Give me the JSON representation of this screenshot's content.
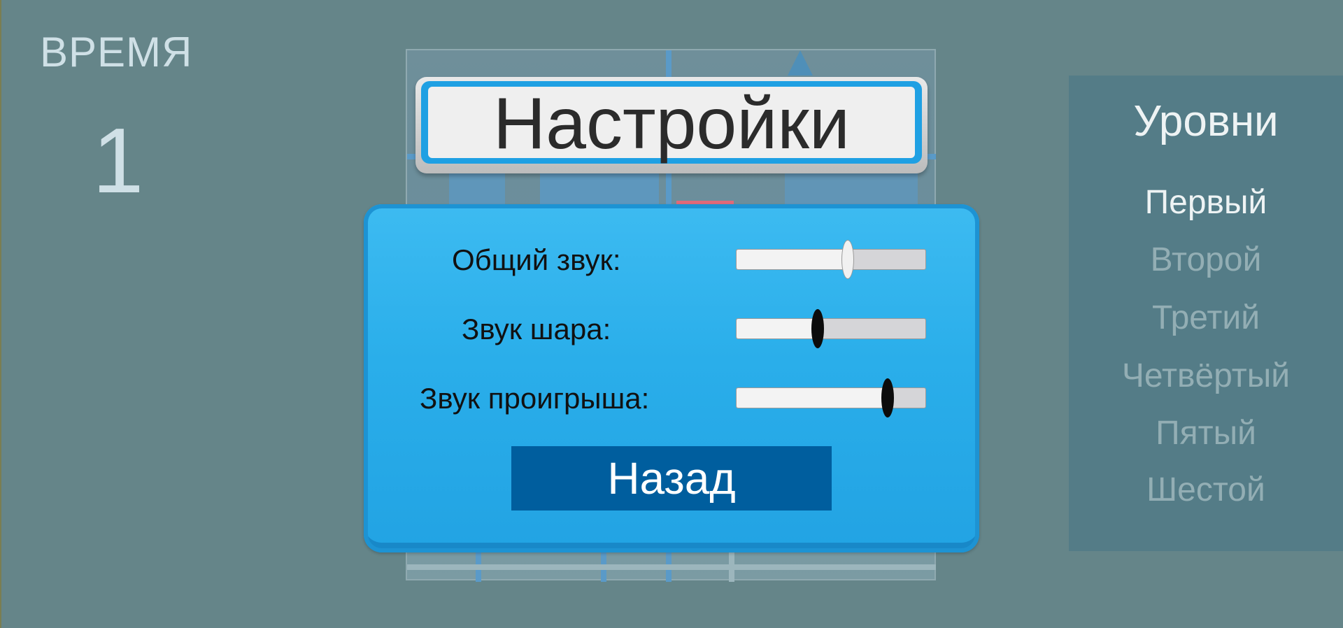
{
  "hud": {
    "time_label": "ВРЕМЯ",
    "time_value": "1"
  },
  "settings": {
    "title": "Настройки",
    "sliders": [
      {
        "label": "Общий звук:",
        "value": 0.59,
        "knob_color": "#f1f1f1"
      },
      {
        "label": "Звук шара:",
        "value": 0.43,
        "knob_color": "#0c0c0c"
      },
      {
        "label": "Звук проигрыша:",
        "value": 0.8,
        "knob_color": "#0c0c0c"
      }
    ],
    "back_label": "Назад"
  },
  "levels": {
    "title": "Уровни",
    "items": [
      "Первый",
      "Второй",
      "Третий",
      "Четвёртый",
      "Пятый",
      "Шестой"
    ],
    "active_index": 0
  },
  "colors": {
    "background": "#658589",
    "panel": "#2aaeea",
    "back_button": "#005e9e",
    "levels_panel": "#547c87"
  }
}
